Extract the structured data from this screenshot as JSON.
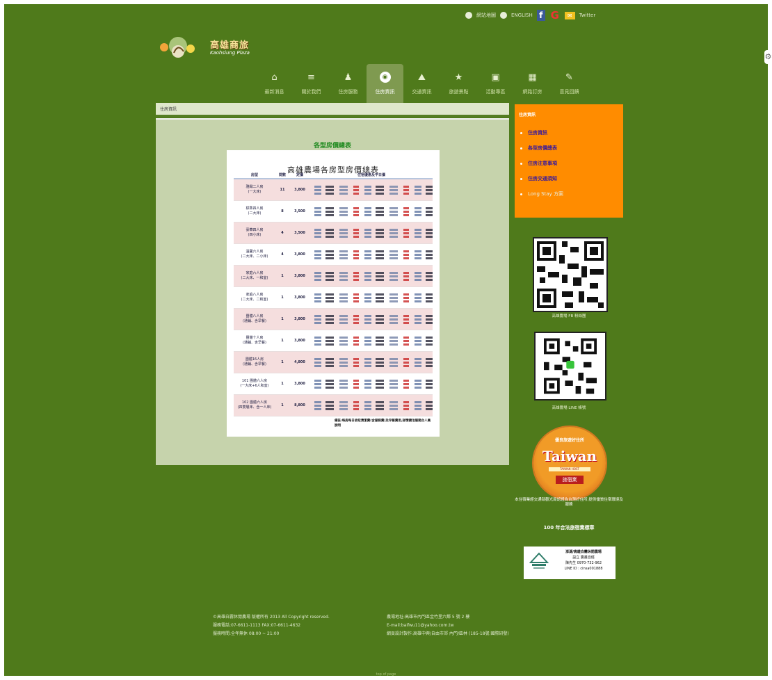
{
  "top_links": {
    "sitemap": "網站地圖",
    "english": "ENGLISH",
    "facebook": "f",
    "google": "G",
    "mail": "✉",
    "extra": "Twitter"
  },
  "logo": {
    "title": "高雄商旅",
    "subtitle": "Kaohsiung Plaza"
  },
  "nav": [
    {
      "icon": "⌂",
      "label": "最新消息"
    },
    {
      "icon": "≡",
      "label": "關於我們"
    },
    {
      "icon": "♟",
      "label": "住房服務"
    },
    {
      "icon": "◉",
      "label": "住房資訊"
    },
    {
      "icon": "⛰",
      "label": "交通資訊"
    },
    {
      "icon": "★",
      "label": "旅遊景點"
    },
    {
      "icon": "▣",
      "label": "活動專區"
    },
    {
      "icon": "▦",
      "label": "網路訂房"
    },
    {
      "icon": "✎",
      "label": "意見回饋"
    }
  ],
  "breadcrumb": "住房資訊",
  "main_title": "各型房價總表",
  "doc": {
    "title": "高雄農場各房型房價總表",
    "headers": [
      "房型",
      "間數",
      "定價",
      "住宿優惠及平日價"
    ],
    "rooms": [
      {
        "name": "雅緻二人房",
        "sub": "(一大床)",
        "count": "11",
        "price": "3,800"
      },
      {
        "name": "標準四人房",
        "sub": "(二大床)",
        "count": "8",
        "price": "3,500"
      },
      {
        "name": "豪華四人房",
        "sub": "(四小床)",
        "count": "4",
        "price": "3,500"
      },
      {
        "name": "溫馨六人房",
        "sub": "(二大床、二小床)",
        "count": "4",
        "price": "3,800"
      },
      {
        "name": "家庭六人房",
        "sub": "(二大床、一和室)",
        "count": "1",
        "price": "3,800"
      },
      {
        "name": "家庭八人房",
        "sub": "(二大床、二和室)",
        "count": "1",
        "price": "3,800"
      },
      {
        "name": "團體八人房",
        "sub": "(通鋪、含早餐)",
        "count": "1",
        "price": "3,800"
      },
      {
        "name": "團體十人房",
        "sub": "(通鋪、含早餐)",
        "count": "1",
        "price": "3,800"
      },
      {
        "name": "團體16人房",
        "sub": "(通鋪、含早餐)",
        "count": "1",
        "price": "4,800"
      },
      {
        "name": "101 團體六人房",
        "sub": "(一大床+6人和室)",
        "count": "1",
        "price": "3,800"
      },
      {
        "name": "102 團體六人房",
        "sub": "(四雙層床、含一人床)",
        "count": "1",
        "price": "8,800"
      }
    ],
    "note": "備註:每房每日收取清潔費(含服務費)及早餐費用,詳情請洽服務台人員說明"
  },
  "side_menu": {
    "heading": "住房資訊",
    "items": [
      "住房資訊",
      "各型房價總表",
      "住房注意事項",
      "住房交通須知",
      "Long Stay 方案"
    ]
  },
  "qr1_caption": "高雄農場 FB 粉絲團",
  "qr2_caption": "高雄農場 LINE 帳號",
  "badge": {
    "arc": "優良旅遊好住所",
    "word": "Taiwan",
    "strip": "TAIWAN HOST",
    "hotel": "旅宿業"
  },
  "badge_caption": "本住宿業經交通部觀光局認證為台灣好住所,提供優質住宿環境及服務",
  "badge_caption2": "100 年合法旅宿業標章",
  "card": {
    "lines": [
      "澎湖/高雄白霧休閒農場",
      "設立 籌畫自經",
      "陳先生 0970-732-962",
      "LINE ID : cinsa001888"
    ]
  },
  "footer_left": [
    "©高雄白霧休閒農場 版權所有 2013 All Copyright reserved.",
    "服務電話:07-6611-1113  FAX:07-6611-4632",
    "服務時間:全年無休 08:00 ~ 21:00"
  ],
  "footer_right": [
    "農場地址:高雄市內門區金竹里六鄰 5 號 2 樓",
    "E-mail:baifwu11@yahoo.com.tw",
    "網頁設計製作:高雄中興/自由市郊 內門/區林 (185-18號 國際研發)"
  ],
  "bottom_text": "top of page",
  "colors": {
    "bg": "#4f7a1b",
    "side": "#ff8c00",
    "main": "#c6d3ac"
  }
}
